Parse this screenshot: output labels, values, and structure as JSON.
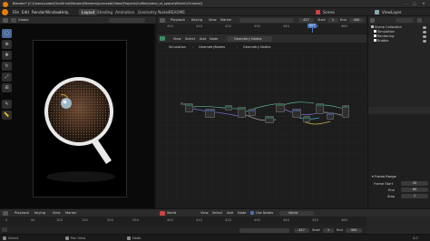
{
  "titlebar": {
    "title": "Blender* [C:\\Users\\codes\\OneDrive\\Render\\Renders\\Jumread\\Video\\Projects\\Coffee\\video_of_space\\Winter\\V3.blend]",
    "minimize": "–",
    "maximize": "□",
    "close": "✕"
  },
  "menubar": {
    "items": [
      "File",
      "Edit",
      "Render",
      "Window",
      "Help"
    ],
    "workspaces": [
      "Layout",
      "Shading",
      "Animation",
      "Geometry Nodes",
      "README"
    ],
    "active_workspace": "Layout",
    "scene_label": "Scene",
    "view_layer_label": "ViewLayer"
  },
  "viewport": {
    "orientation_label": "Global",
    "toolbar_icons": [
      "select-box-icon",
      "cursor-icon",
      "move-icon",
      "rotate-icon",
      "scale-icon",
      "transform-icon",
      "annotate-icon",
      "measure-icon"
    ]
  },
  "mid_top": {
    "header_items": [
      "Playback",
      "Keying",
      "View",
      "Marker"
    ],
    "start_label": "Start",
    "start_value": "1",
    "end_label": "End",
    "end_value": "400",
    "current_frame": "427",
    "ruler_ticks": [
      "400",
      "410",
      "420",
      "430",
      "440",
      "450",
      "460"
    ],
    "playhead_value": "427"
  },
  "node_editor": {
    "header_items": [
      "View",
      "Select",
      "Add",
      "Node"
    ],
    "node_tree_name": "Geometry Nodes",
    "breadcrumb": [
      "Simulation",
      "GeometryNodes",
      "Geometry Nodes"
    ],
    "frame_label": "Plan"
  },
  "outliner": {
    "header_label": "Scene Collection",
    "rows": [
      "Scene Collection",
      "Simulation",
      "Rendering",
      "Bubble"
    ]
  },
  "properties": {
    "section": "Frame Range",
    "frame_start_label": "Frame Start",
    "frame_start_value": "20",
    "end_label": "End",
    "end_value": "60",
    "step_label": "Step",
    "step_value": "1"
  },
  "bottom_left_tl": {
    "header_items": [
      "Playback",
      "Keying",
      "View",
      "Marker"
    ],
    "ruler_ticks": [
      "0",
      "50",
      "100",
      "150",
      "200",
      "250"
    ]
  },
  "bottom_mid": {
    "world_label": "World",
    "header_items": [
      "View",
      "Select",
      "Add",
      "Node"
    ],
    "use_nodes_label": "Use Nodes",
    "world_name": "World",
    "ruler_ticks": [
      "400",
      "410",
      "420",
      "430",
      "440",
      "450",
      "460"
    ],
    "start_label": "Start",
    "start_value": "1",
    "end_label": "End",
    "end_value": "400",
    "current_frame": "427"
  },
  "statusbar": {
    "left": "Select",
    "mid1": "Pan View",
    "mid2": "Node",
    "right": "4.0"
  },
  "colors": {
    "accent_blue": "#4772b3",
    "blender_orange": "#e87d0d",
    "node_green": "#2f5f4a"
  }
}
